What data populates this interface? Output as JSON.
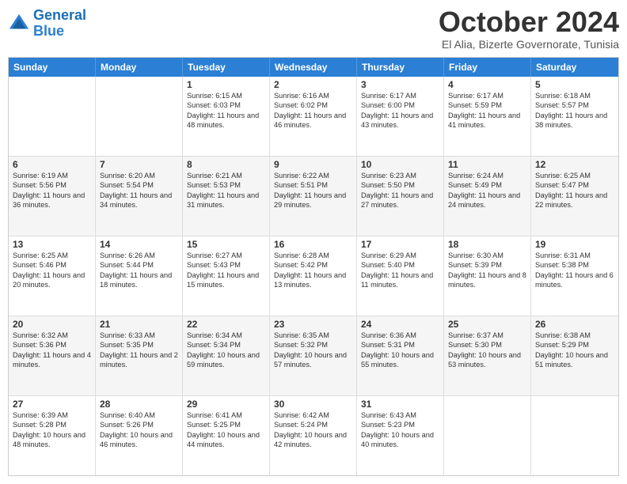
{
  "header": {
    "logo_line1": "General",
    "logo_line2": "Blue",
    "month": "October 2024",
    "location": "El Alia, Bizerte Governorate, Tunisia"
  },
  "days": [
    "Sunday",
    "Monday",
    "Tuesday",
    "Wednesday",
    "Thursday",
    "Friday",
    "Saturday"
  ],
  "rows": [
    [
      {
        "day": "",
        "info": ""
      },
      {
        "day": "",
        "info": ""
      },
      {
        "day": "1",
        "info": "Sunrise: 6:15 AM\nSunset: 6:03 PM\nDaylight: 11 hours and 48 minutes."
      },
      {
        "day": "2",
        "info": "Sunrise: 6:16 AM\nSunset: 6:02 PM\nDaylight: 11 hours and 46 minutes."
      },
      {
        "day": "3",
        "info": "Sunrise: 6:17 AM\nSunset: 6:00 PM\nDaylight: 11 hours and 43 minutes."
      },
      {
        "day": "4",
        "info": "Sunrise: 6:17 AM\nSunset: 5:59 PM\nDaylight: 11 hours and 41 minutes."
      },
      {
        "day": "5",
        "info": "Sunrise: 6:18 AM\nSunset: 5:57 PM\nDaylight: 11 hours and 38 minutes."
      }
    ],
    [
      {
        "day": "6",
        "info": "Sunrise: 6:19 AM\nSunset: 5:56 PM\nDaylight: 11 hours and 36 minutes."
      },
      {
        "day": "7",
        "info": "Sunrise: 6:20 AM\nSunset: 5:54 PM\nDaylight: 11 hours and 34 minutes."
      },
      {
        "day": "8",
        "info": "Sunrise: 6:21 AM\nSunset: 5:53 PM\nDaylight: 11 hours and 31 minutes."
      },
      {
        "day": "9",
        "info": "Sunrise: 6:22 AM\nSunset: 5:51 PM\nDaylight: 11 hours and 29 minutes."
      },
      {
        "day": "10",
        "info": "Sunrise: 6:23 AM\nSunset: 5:50 PM\nDaylight: 11 hours and 27 minutes."
      },
      {
        "day": "11",
        "info": "Sunrise: 6:24 AM\nSunset: 5:49 PM\nDaylight: 11 hours and 24 minutes."
      },
      {
        "day": "12",
        "info": "Sunrise: 6:25 AM\nSunset: 5:47 PM\nDaylight: 11 hours and 22 minutes."
      }
    ],
    [
      {
        "day": "13",
        "info": "Sunrise: 6:25 AM\nSunset: 5:46 PM\nDaylight: 11 hours and 20 minutes."
      },
      {
        "day": "14",
        "info": "Sunrise: 6:26 AM\nSunset: 5:44 PM\nDaylight: 11 hours and 18 minutes."
      },
      {
        "day": "15",
        "info": "Sunrise: 6:27 AM\nSunset: 5:43 PM\nDaylight: 11 hours and 15 minutes."
      },
      {
        "day": "16",
        "info": "Sunrise: 6:28 AM\nSunset: 5:42 PM\nDaylight: 11 hours and 13 minutes."
      },
      {
        "day": "17",
        "info": "Sunrise: 6:29 AM\nSunset: 5:40 PM\nDaylight: 11 hours and 11 minutes."
      },
      {
        "day": "18",
        "info": "Sunrise: 6:30 AM\nSunset: 5:39 PM\nDaylight: 11 hours and 8 minutes."
      },
      {
        "day": "19",
        "info": "Sunrise: 6:31 AM\nSunset: 5:38 PM\nDaylight: 11 hours and 6 minutes."
      }
    ],
    [
      {
        "day": "20",
        "info": "Sunrise: 6:32 AM\nSunset: 5:36 PM\nDaylight: 11 hours and 4 minutes."
      },
      {
        "day": "21",
        "info": "Sunrise: 6:33 AM\nSunset: 5:35 PM\nDaylight: 11 hours and 2 minutes."
      },
      {
        "day": "22",
        "info": "Sunrise: 6:34 AM\nSunset: 5:34 PM\nDaylight: 10 hours and 59 minutes."
      },
      {
        "day": "23",
        "info": "Sunrise: 6:35 AM\nSunset: 5:32 PM\nDaylight: 10 hours and 57 minutes."
      },
      {
        "day": "24",
        "info": "Sunrise: 6:36 AM\nSunset: 5:31 PM\nDaylight: 10 hours and 55 minutes."
      },
      {
        "day": "25",
        "info": "Sunrise: 6:37 AM\nSunset: 5:30 PM\nDaylight: 10 hours and 53 minutes."
      },
      {
        "day": "26",
        "info": "Sunrise: 6:38 AM\nSunset: 5:29 PM\nDaylight: 10 hours and 51 minutes."
      }
    ],
    [
      {
        "day": "27",
        "info": "Sunrise: 6:39 AM\nSunset: 5:28 PM\nDaylight: 10 hours and 48 minutes."
      },
      {
        "day": "28",
        "info": "Sunrise: 6:40 AM\nSunset: 5:26 PM\nDaylight: 10 hours and 46 minutes."
      },
      {
        "day": "29",
        "info": "Sunrise: 6:41 AM\nSunset: 5:25 PM\nDaylight: 10 hours and 44 minutes."
      },
      {
        "day": "30",
        "info": "Sunrise: 6:42 AM\nSunset: 5:24 PM\nDaylight: 10 hours and 42 minutes."
      },
      {
        "day": "31",
        "info": "Sunrise: 6:43 AM\nSunset: 5:23 PM\nDaylight: 10 hours and 40 minutes."
      },
      {
        "day": "",
        "info": ""
      },
      {
        "day": "",
        "info": ""
      }
    ]
  ]
}
